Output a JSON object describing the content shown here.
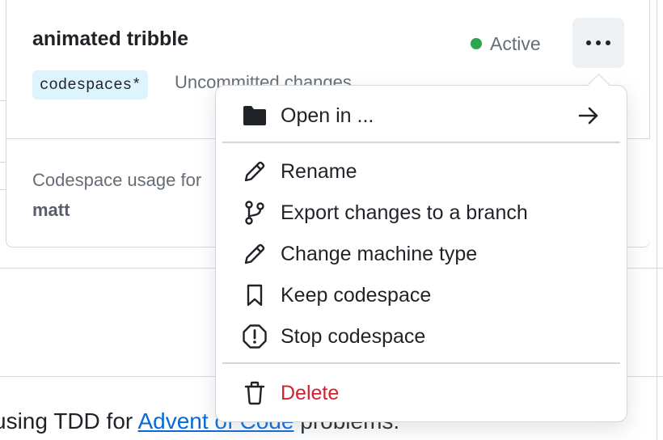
{
  "codespace": {
    "name": "animated tribble",
    "branch": "codespaces*",
    "changes_status": "Uncommitted changes",
    "status": "Active"
  },
  "usage": {
    "label": "Codespace usage for",
    "user": "matt"
  },
  "readme": {
    "text_before": "using TDD for ",
    "link_text": "Advent of Code",
    "text_after": " problems."
  },
  "menu": {
    "open_in": "Open in ...",
    "rename": "Rename",
    "export": "Export changes to a branch",
    "change_machine": "Change machine type",
    "keep": "Keep codespace",
    "stop": "Stop codespace",
    "delete": "Delete"
  },
  "colors": {
    "active": "#2da44e",
    "danger": "#cf222e",
    "link": "#0969da",
    "branch_bg": "#ddf4ff"
  }
}
